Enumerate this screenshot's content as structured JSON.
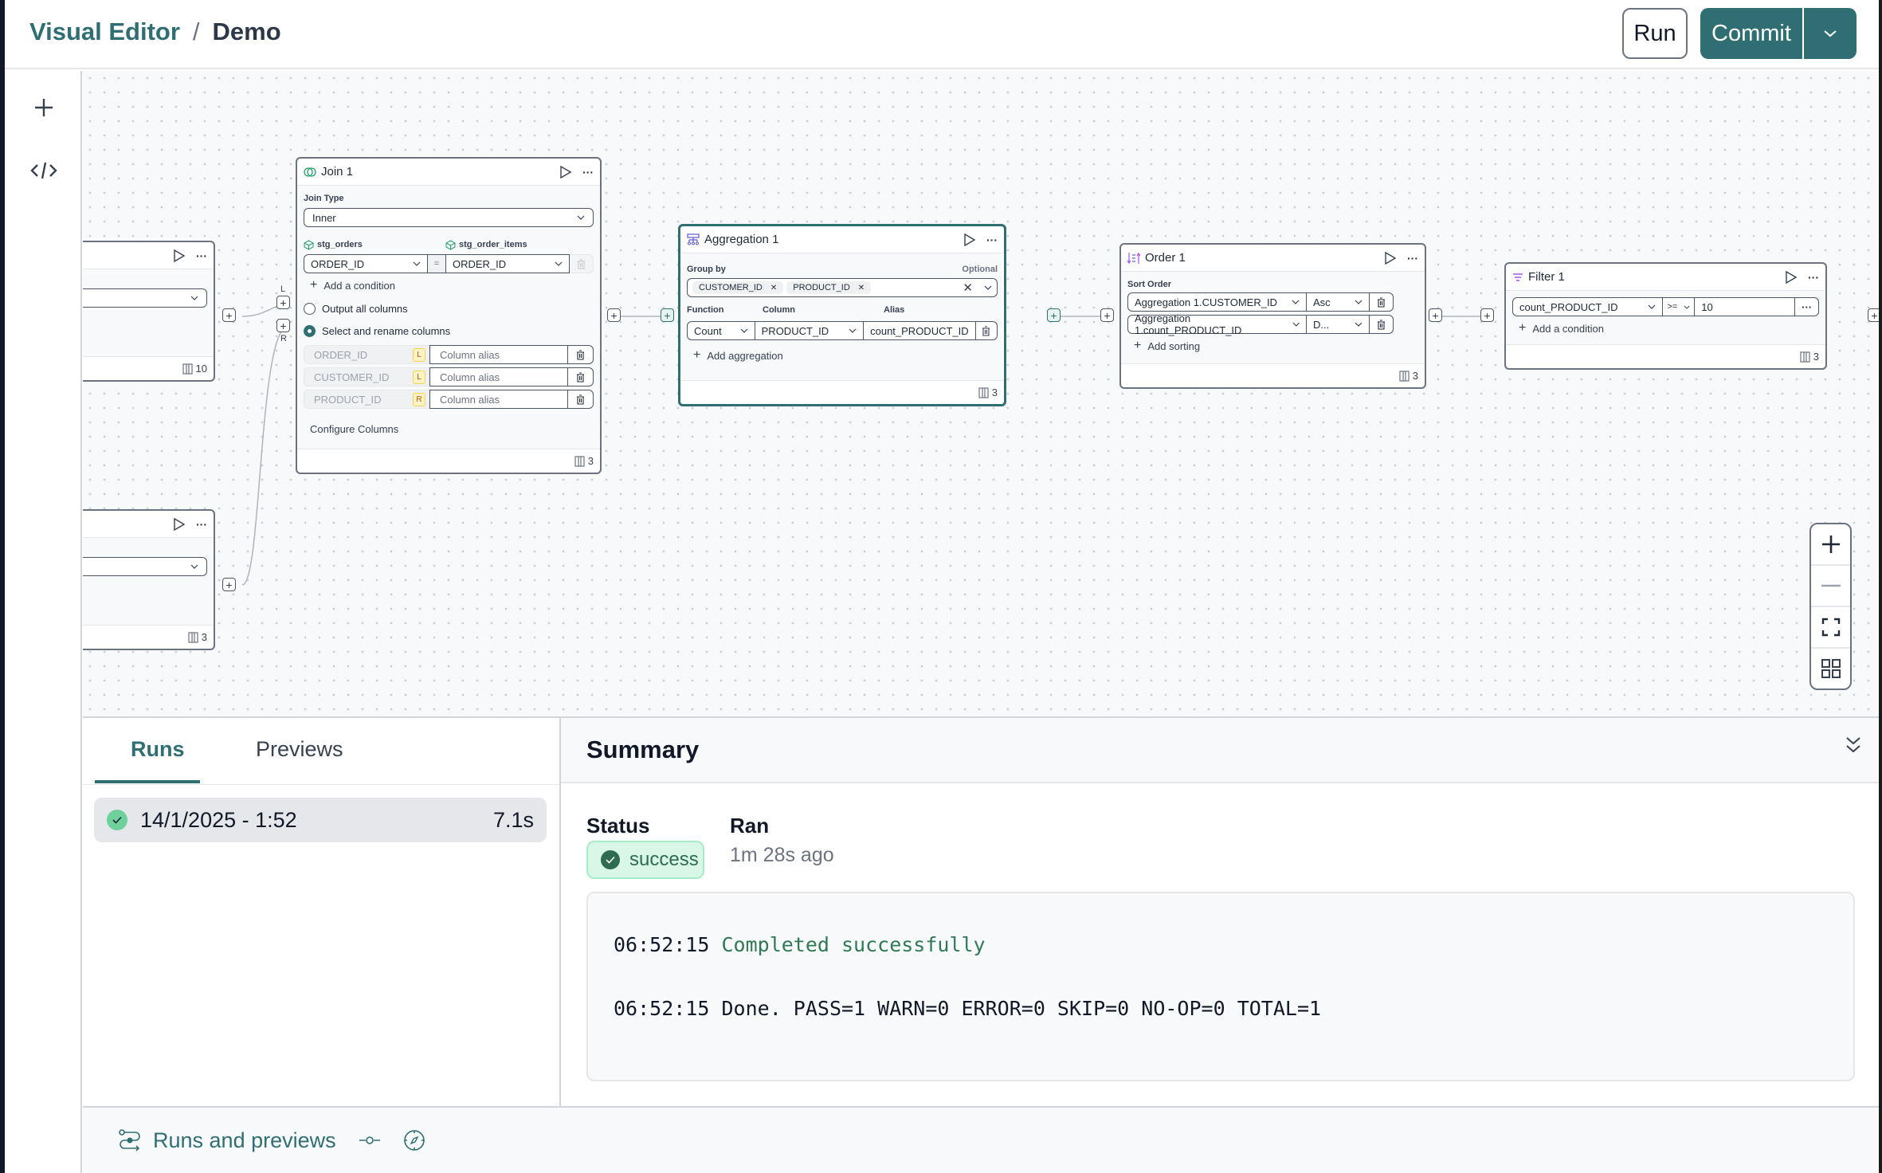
{
  "header": {
    "breadcrumb_root": "Visual Editor",
    "breadcrumb_sep": "/",
    "breadcrumb_current": "Demo",
    "run_label": "Run",
    "commit_label": "Commit"
  },
  "colors": {
    "accent": "#2f6f73",
    "success_bg": "#d8f7e6",
    "success_text": "#2f6b4f",
    "aggregation_icon": "#5b5bd6",
    "order_icon": "#a855f7",
    "filter_icon": "#a855f7"
  },
  "canvas": {
    "source_node_top": {
      "footer_count": "10"
    },
    "source_node_bottom": {
      "footer_count": "3"
    },
    "join": {
      "title": "Join 1",
      "join_type_label": "Join Type",
      "join_type_value": "Inner",
      "left_source": "stg_orders",
      "right_source": "stg_order_items",
      "left_key": "ORDER_ID",
      "operator": "=",
      "right_key": "ORDER_ID",
      "add_condition": "Add a condition",
      "output_all_label": "Output all columns",
      "select_rename_label": "Select and rename columns",
      "columns": [
        {
          "name": "ORDER_ID",
          "side": "L",
          "alias_placeholder": "Column alias"
        },
        {
          "name": "CUSTOMER_ID",
          "side": "L",
          "alias_placeholder": "Column alias"
        },
        {
          "name": "PRODUCT_ID",
          "side": "R",
          "alias_placeholder": "Column alias"
        }
      ],
      "configure_columns": "Configure Columns",
      "footer_count": "3",
      "port_left_label": "L",
      "port_right_label": "R"
    },
    "aggregation": {
      "title": "Aggregation 1",
      "group_by_label": "Group by",
      "optional_label": "Optional",
      "group_by_chips": [
        "CUSTOMER_ID",
        "PRODUCT_ID"
      ],
      "function_label": "Function",
      "column_label": "Column",
      "alias_label": "Alias",
      "function_value": "Count",
      "column_value": "PRODUCT_ID",
      "alias_value": "count_PRODUCT_ID",
      "add_aggregation": "Add aggregation",
      "footer_count": "3"
    },
    "order": {
      "title": "Order 1",
      "sort_order_label": "Sort Order",
      "sorts": [
        {
          "column": "Aggregation 1.CUSTOMER_ID",
          "direction": "Asc"
        },
        {
          "column": "Aggregation 1.count_PRODUCT_ID",
          "direction": "D..."
        }
      ],
      "add_sorting": "Add sorting",
      "footer_count": "3"
    },
    "filter": {
      "title": "Filter 1",
      "column": "count_PRODUCT_ID",
      "operator": ">=",
      "value": "10",
      "add_condition": "Add a condition",
      "footer_count": "3"
    }
  },
  "runs_panel": {
    "tabs": [
      {
        "label": "Runs",
        "active": true
      },
      {
        "label": "Previews",
        "active": false
      }
    ],
    "runs": [
      {
        "timestamp": "14/1/2025 - 1:52",
        "duration": "7.1s",
        "status": "success"
      }
    ]
  },
  "summary": {
    "title": "Summary",
    "status_label": "Status",
    "status_value": "success",
    "ran_label": "Ran",
    "ran_value": "1m 28s ago",
    "log": [
      {
        "time": "06:52:15",
        "message": "Completed successfully"
      },
      {
        "time": "06:52:15",
        "message": "Done. PASS=1 WARN=0 ERROR=0 SKIP=0 NO-OP=0 TOTAL=1"
      }
    ]
  },
  "footer": {
    "runs_and_previews": "Runs and previews"
  }
}
